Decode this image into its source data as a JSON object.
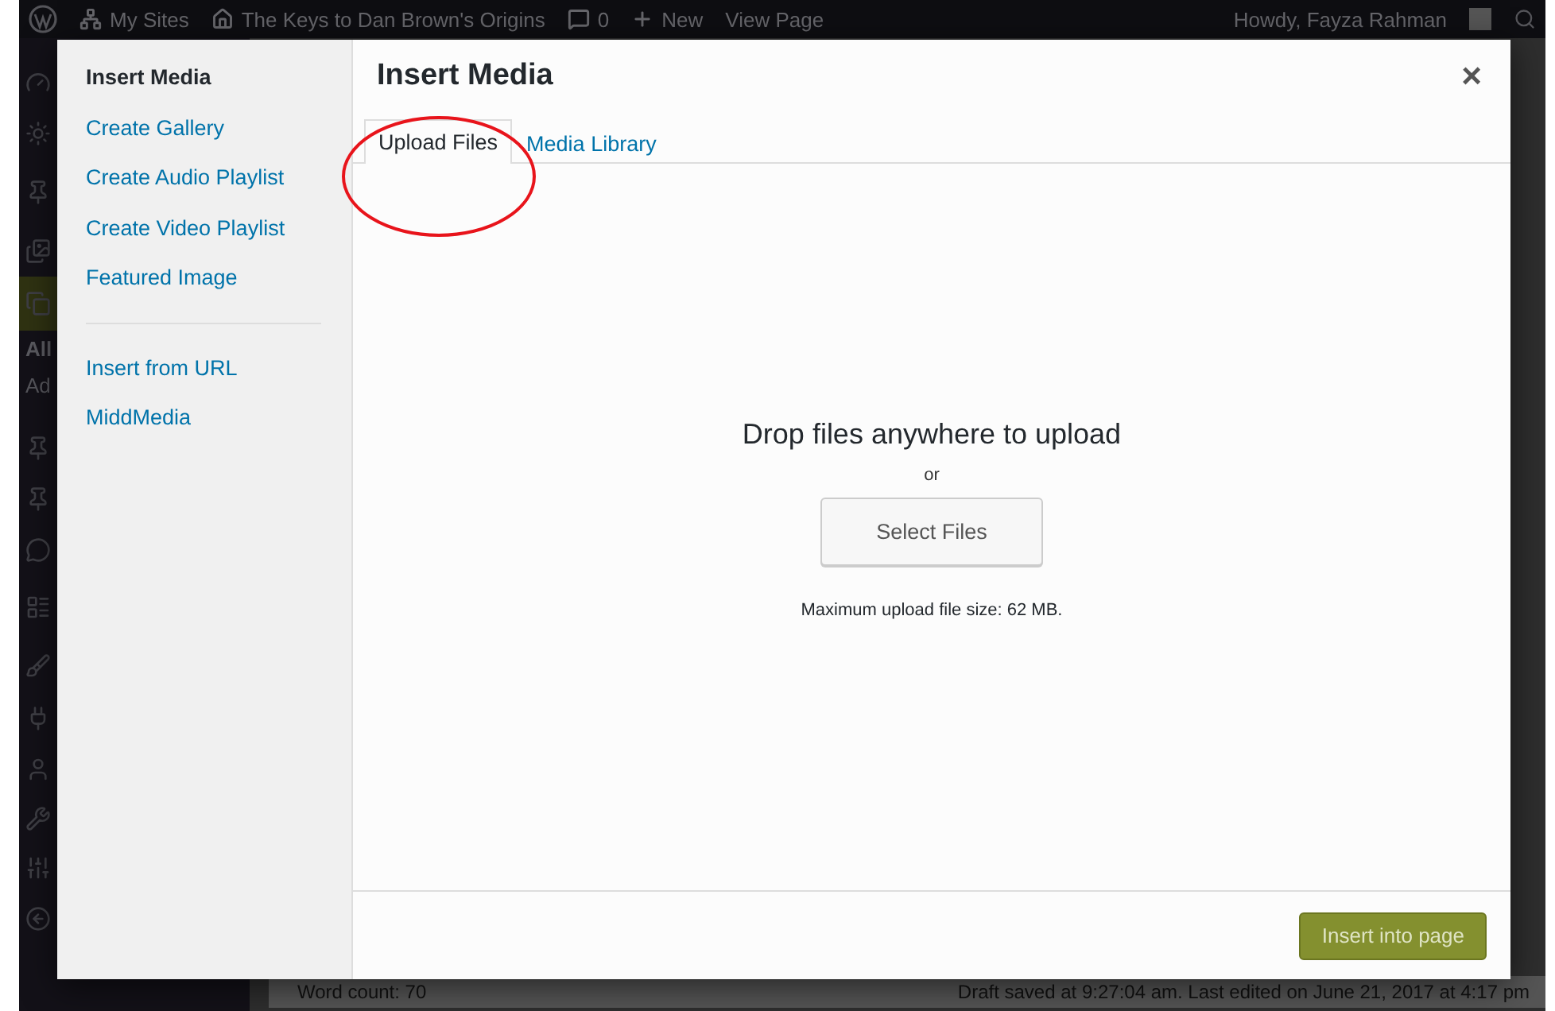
{
  "admin_bar": {
    "items": [
      {
        "kind": "logo"
      },
      {
        "kind": "link",
        "label": "My Sites"
      },
      {
        "kind": "link",
        "label": "The Keys to Dan Brown's Origins"
      },
      {
        "kind": "link",
        "label": "0"
      },
      {
        "kind": "link",
        "label": "New"
      },
      {
        "kind": "link",
        "label": "View Page"
      }
    ],
    "greeting": "Howdy, Fayza Rahman"
  },
  "side_menu": {
    "texts": [
      "All",
      "Ad"
    ]
  },
  "footer": {
    "word_count": "Word count: 70",
    "status": "Draft saved at 9:27:04 am. Last edited on June 21, 2017 at 4:17 pm"
  },
  "modal": {
    "menu": [
      {
        "label": "Insert Media",
        "selected": true
      },
      {
        "label": "Create Gallery",
        "selected": false
      },
      {
        "label": "Create Audio Playlist",
        "selected": false
      },
      {
        "label": "Create Video Playlist",
        "selected": false
      },
      {
        "label": "Featured Image",
        "selected": false
      },
      {
        "kind": "separator"
      },
      {
        "label": "Insert from URL",
        "selected": false
      },
      {
        "label": "MiddMedia",
        "selected": false
      }
    ],
    "title": "Insert Media",
    "close": "×",
    "tabs": [
      {
        "label": "Upload Files",
        "selected": true,
        "highlighted": true
      },
      {
        "label": "Media Library",
        "selected": false,
        "highlighted": false
      }
    ],
    "upload": {
      "heading": "Drop files anywhere to upload",
      "or": "or",
      "button": "Select Files",
      "note": "Maximum upload file size: 62 MB."
    },
    "primary_button": {
      "label": "Insert into page",
      "disabled": true
    }
  }
}
